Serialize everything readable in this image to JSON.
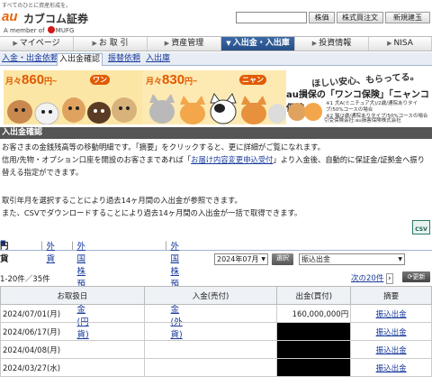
{
  "header": {
    "tagline": "すべてのひとに資産形成を。",
    "logo_au": "au",
    "logo_name": "カブコム証券",
    "member_of": "A member of",
    "mufg": "MUFG",
    "search_placeholder": "",
    "search_button": "株価",
    "order_button": "株式買注文",
    "new_button": "新規建玉"
  },
  "main_nav": [
    {
      "label": "マイページ"
    },
    {
      "label": "お 取 引"
    },
    {
      "label": "資産管理"
    },
    {
      "label": "入出金・入出庫"
    },
    {
      "label": "投資情報"
    },
    {
      "label": "NISA"
    }
  ],
  "sub_nav": [
    {
      "label": "入金・出金依頼"
    },
    {
      "label": "入出金確認"
    },
    {
      "label": "振替依頼"
    },
    {
      "label": "入出庫"
    }
  ],
  "banner": {
    "price1_prefix": "月々",
    "price1": "860",
    "price1_suffix": "円~",
    "badge1": "ワン",
    "price2_prefix": "月々",
    "price2": "830",
    "price2_suffix": "円~",
    "badge2": "ニャン",
    "catch": "ほしい安心、もらってる。",
    "title": "au損保の「ワンコ保険」「ニャンコ保険」",
    "note1": "※1 犬A(ミニチュア犬)/2歳/通院ありタイプ/50%コースの場合",
    "note2": "※2 猫/2歳/通院ありタイプ/50%コースの場合",
    "credit": "引受保険会社:au損害保険株式会社"
  },
  "section_title": "入出金確認",
  "description": {
    "line1": "お客さまの金銭残高等の移動明細です。「摘要」をクリックすると、更に詳細がご覧になれます。",
    "line2_a": "信用/先物・オプション口座を開設のお客さまであれば「",
    "line2_link": "お届け内容変更申込受付",
    "line2_b": "」より入金後、自動的に保証金/証拠金へ振り",
    "line3": "替える指定ができます。",
    "line4": "取引年月を選択することにより過去14ヶ月間の入出金が参照できます。",
    "line5": "また、CSVでダウンロードすることにより過去14ヶ月間の入出金が一括で取得できます。"
  },
  "csv_label": "CSV",
  "currency_tabs": {
    "yen": "円貨",
    "foreign": "外貨",
    "fx_deposit_yen": "外国株預り金(円貨)",
    "fx_deposit_fx": "外国株預り金(外貨)"
  },
  "controls": {
    "month": "2024年07月",
    "select_button": "選択",
    "category": "振込出金"
  },
  "paging": {
    "count": "1-20件／35件",
    "next": "次の20件",
    "refresh": "更新"
  },
  "table": {
    "columns": [
      "お取扱日",
      "入金(売付)",
      "出金(買付)",
      "摘要"
    ],
    "rows": [
      {
        "date": "2024/07/01(月)",
        "in": "",
        "out": "160,000,000円",
        "memo": "振込出金",
        "redact_out": false
      },
      {
        "date": "2024/06/17(月)",
        "in": "",
        "out": "",
        "memo": "振込出金",
        "redact_out": true
      },
      {
        "date": "2024/04/08(月)",
        "in": "",
        "out": "",
        "memo": "振込出金",
        "redact_out": true
      },
      {
        "date": "2024/03/27(水)",
        "in": "",
        "out": "",
        "memo": "振込出金",
        "redact_out": true
      }
    ]
  },
  "colors": {
    "nav_active": "#2f5d99",
    "section_header": "#555555",
    "brand_orange": "#e8650a",
    "link": "#1a3c9c"
  }
}
